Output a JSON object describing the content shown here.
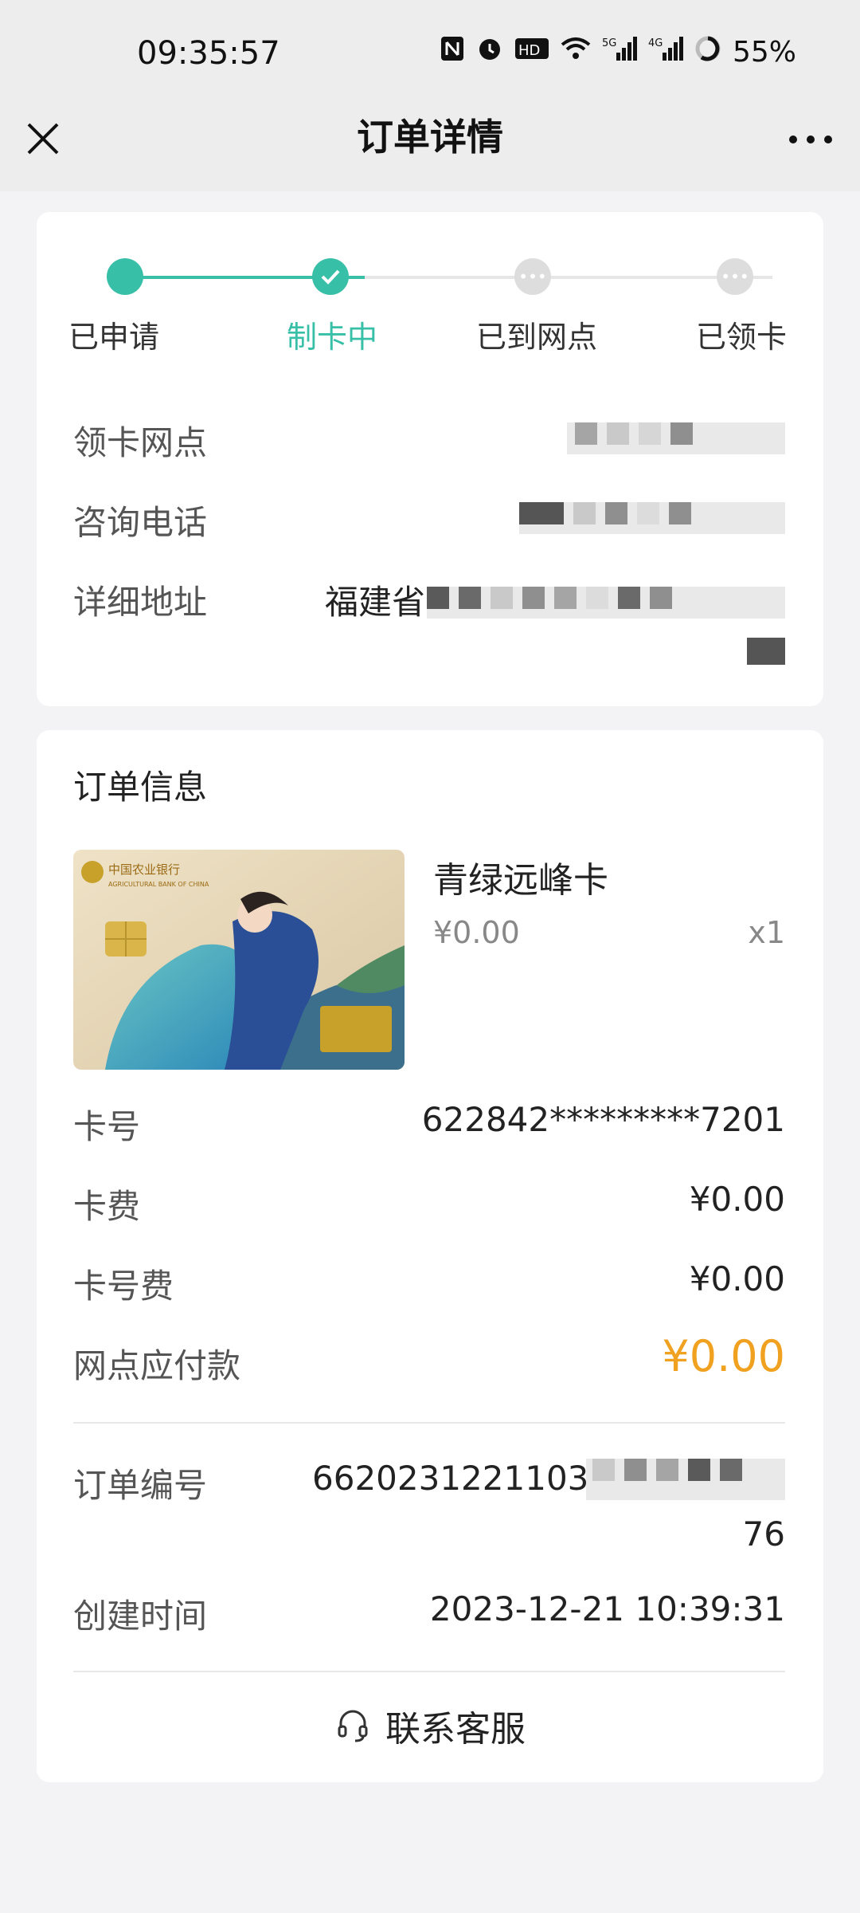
{
  "status_bar": {
    "time": "09:35:57",
    "battery": "55%",
    "network_labels": [
      "5G",
      "4G"
    ]
  },
  "nav": {
    "title": "订单详情"
  },
  "progress": {
    "steps": [
      "已申请",
      "制卡中",
      "已到网点",
      "已领卡"
    ],
    "current_index": 1
  },
  "branch": {
    "branch_label": "领卡网点",
    "phone_label": "咨询电话",
    "address_label": "详细地址",
    "address_value": "福建省"
  },
  "order": {
    "section_title": "订单信息",
    "product_name": "青绿远峰卡",
    "product_price": "¥0.00",
    "product_qty": "x1",
    "card_bank_name": "中国农业银行",
    "rows": [
      {
        "label": "卡号",
        "value": "622842*********7201"
      },
      {
        "label": "卡费",
        "value": "¥0.00"
      },
      {
        "label": "卡号费",
        "value": "¥0.00"
      },
      {
        "label": "网点应付款",
        "value": "¥0.00"
      }
    ],
    "order_no_label": "订单编号",
    "order_no_value": "66202312211039",
    "order_no_tail": "76",
    "created_label": "创建时间",
    "created_value": "2023-12-21 10:39:31",
    "service_label": "联系客服"
  },
  "colors": {
    "accent": "#38bfa7",
    "price": "#f0a11f"
  }
}
